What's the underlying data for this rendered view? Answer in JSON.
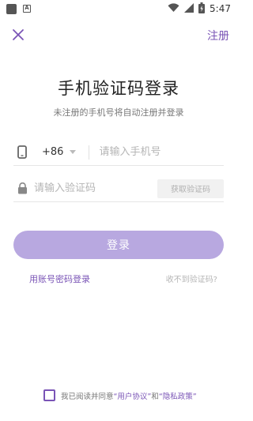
{
  "status_bar": {
    "time": "5:47",
    "icons": [
      "app-square-icon",
      "a-notification-icon",
      "wifi-icon",
      "signal-icon",
      "battery-icon"
    ]
  },
  "header": {
    "close_icon": "close-icon",
    "register_label": "注册"
  },
  "title": "手机验证码登录",
  "subtitle": "未注册的手机号将自动注册并登录",
  "phone": {
    "country_code": "+86",
    "placeholder": "请输入手机号",
    "value": ""
  },
  "code": {
    "placeholder": "请输入验证码",
    "value": "",
    "get_code_label": "获取验证码"
  },
  "login_button": "登录",
  "account_login_link": "用账号密码登录",
  "no_code_link": "收不到验证码?",
  "agreement": {
    "prefix": "我已阅读并同意",
    "user_agreement": "“用户协议”",
    "and": "和",
    "privacy_policy": "“隐私政策”"
  },
  "colors": {
    "accent": "#7a54b6",
    "login_button": "#b8a8e0"
  }
}
